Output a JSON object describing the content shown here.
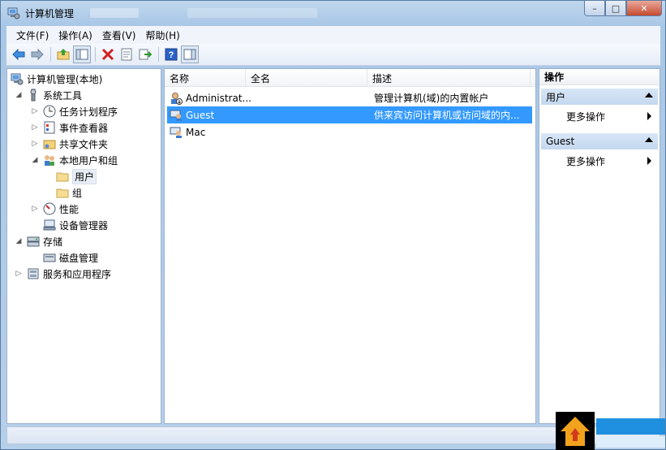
{
  "window": {
    "title": "计算机管理",
    "buttons": {
      "minimize": "–",
      "maximize": "□",
      "close": "✕"
    }
  },
  "menu": [
    "文件(F)",
    "操作(A)",
    "查看(V)",
    "帮助(H)"
  ],
  "toolbar": {
    "icons": [
      "back-arrow-icon",
      "forward-arrow-icon",
      "up-folder-icon",
      "show-hide-tree-icon",
      "delete-icon",
      "properties-icon",
      "export-icon",
      "help-icon",
      "show-hide-action-pane-icon"
    ]
  },
  "tree": [
    {
      "label": "计算机管理(本地)",
      "icon": "computer-manage-icon"
    },
    {
      "label": "系统工具",
      "icon": "system-tools-icon",
      "toggle": "◢"
    },
    {
      "label": "任务计划程序",
      "icon": "clock-icon",
      "toggle": "▷"
    },
    {
      "label": "事件查看器",
      "icon": "event-viewer-icon",
      "toggle": "▷"
    },
    {
      "label": "共享文件夹",
      "icon": "shared-folder-icon",
      "toggle": "▷"
    },
    {
      "label": "本地用户和组",
      "icon": "users-group-icon",
      "toggle": "◢"
    },
    {
      "label": "用户",
      "icon": "folder-icon"
    },
    {
      "label": "组",
      "icon": "folder-icon"
    },
    {
      "label": "性能",
      "icon": "performance-icon",
      "toggle": "▷"
    },
    {
      "label": "设备管理器",
      "icon": "device-manager-icon"
    },
    {
      "label": "存储",
      "icon": "storage-icon",
      "toggle": "◢"
    },
    {
      "label": "磁盘管理",
      "icon": "disk-management-icon"
    },
    {
      "label": "服务和应用程序",
      "icon": "services-icon",
      "toggle": "▷"
    }
  ],
  "list": {
    "columns": [
      "名称",
      "全名",
      "描述"
    ],
    "rows": [
      {
        "name": "Administrat...",
        "fullname": "",
        "description": "管理计算机(域)的内置帐户",
        "icon": "admin-user-icon"
      },
      {
        "name": "Guest",
        "fullname": "",
        "description": "供来宾访问计算机或访问域的内...",
        "icon": "guest-user-icon",
        "selected": true
      },
      {
        "name": "Mac",
        "fullname": "",
        "description": "",
        "icon": "user-icon"
      }
    ]
  },
  "actions": {
    "title": "操作",
    "sections": [
      {
        "label": "用户",
        "items": [
          "更多操作"
        ]
      },
      {
        "label": "Guest",
        "items": [
          "更多操作"
        ]
      }
    ]
  },
  "colors": {
    "selection": "#3399ff",
    "frame": "#a9c7e6",
    "close": "#c74a2f"
  }
}
